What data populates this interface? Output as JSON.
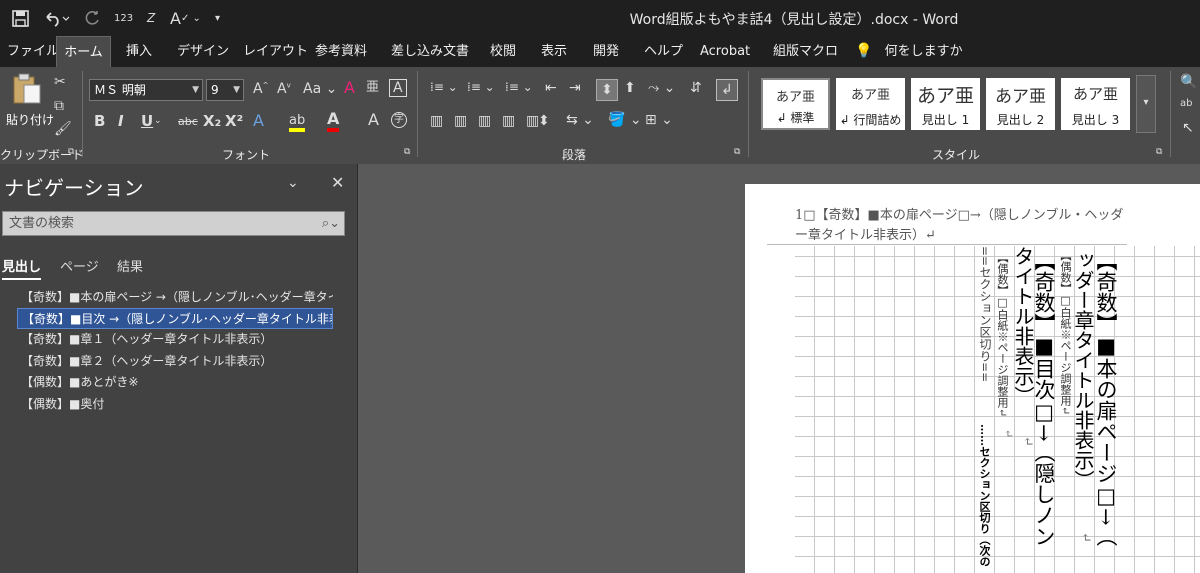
{
  "window": {
    "title": "Word組版よもやま話4（見出し設定）.docx  -  Word"
  },
  "quick_access": {
    "save_icon": "save-icon",
    "undo_icon": "undo-icon",
    "redo_icon": "redo-icon",
    "numbering_label": "123",
    "sort_label": "Z"
  },
  "tabs": [
    "ファイル",
    "ホーム",
    "挿入",
    "デザイン",
    "レイアウト",
    "参考資料",
    "差し込み文書",
    "校閲",
    "表示",
    "開発",
    "ヘルプ",
    "Acrobat",
    "組版マクロ"
  ],
  "tell_me": "何をしますか",
  "ribbon": {
    "clipboard": {
      "paste_label": "貼り付け",
      "group_label": "クリップボード"
    },
    "font": {
      "font_name": "ＭＳ 明朝",
      "font_size": "9",
      "group_label": "フォント",
      "bold": "B",
      "italic": "I",
      "underline": "U",
      "strike": "abc",
      "subscript": "X₂",
      "superscript": "X²",
      "grow": "A",
      "shrink": "A",
      "case": "Aa",
      "char_border": "A",
      "char_a": "A",
      "phonetic": "字"
    },
    "paragraph": {
      "group_label": "段落"
    },
    "styles": {
      "group_label": "スタイル",
      "items": [
        {
          "preview": "あア亜",
          "name": "↲ 標準"
        },
        {
          "preview": "あア亜",
          "name": "↲ 行間詰め"
        },
        {
          "preview": "あア亜",
          "name": "見出し 1"
        },
        {
          "preview": "あア亜",
          "name": "見出し 2"
        },
        {
          "preview": "あア亜",
          "name": "見出し 3"
        }
      ]
    }
  },
  "navigation": {
    "title": "ナビゲーション",
    "search_placeholder": "文書の検索",
    "tabs": [
      "見出し",
      "ページ",
      "結果"
    ],
    "items": [
      "【奇数】■本の扉ページ →（隠しノンブル･ヘッダー章タイトル…",
      "【奇数】■目次 →（隠しノンブル･ヘッダー章タイトル非表示）",
      "【奇数】■章１（ヘッダー章タイトル非表示）",
      "【奇数】■章２（ヘッダー章タイトル非表示）",
      "【偶数】■あとがき※",
      "【偶数】■奥付"
    ]
  },
  "document": {
    "header_text": "1□【奇数】■本の扉ページ□→（隠しノンブル・ヘッダー章タイトル非表示）↵",
    "columns": [
      "【奇数】■本の扉ページ□→（",
      "ッダー章タイトル非表示）",
      "【偶数】□白紙※ページ調整用↵",
      "↵",
      "【奇数】■目次□→（隠しノン",
      "タイトル非表示）",
      "↵",
      "【偶数】□白紙※ページ調整用↵",
      "==セクション区切り==",
      "……セクション区切り（次の",
      "↵"
    ]
  }
}
